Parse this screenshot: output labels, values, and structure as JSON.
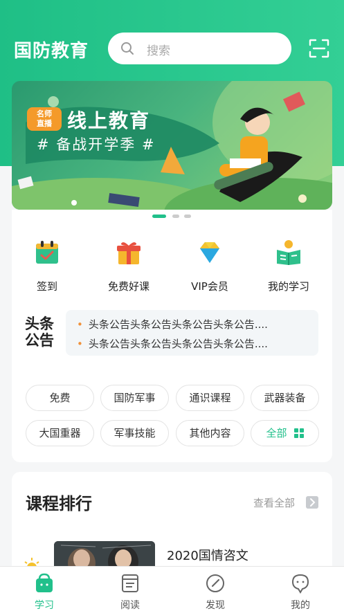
{
  "header": {
    "app_title": "国防教育",
    "search_placeholder": "搜索"
  },
  "banner": {
    "tag_line1": "名师",
    "tag_line2": "直播",
    "title": "线上教育",
    "subtitle": "# 备战开学季 #",
    "page_count": 3,
    "active_page": 1
  },
  "quick_actions": [
    {
      "label": "签到",
      "icon": "calendar-check-icon"
    },
    {
      "label": "免费好课",
      "icon": "gift-icon"
    },
    {
      "label": "VIP会员",
      "icon": "diamond-icon"
    },
    {
      "label": "我的学习",
      "icon": "book-reader-icon"
    }
  ],
  "news": {
    "logo_line1": "头条",
    "logo_line2": "公告",
    "items": [
      "头条公告头条公告头条公告头条公告....",
      "头条公告头条公告头条公告头条公告...."
    ]
  },
  "categories": [
    "免费",
    "国防军事",
    "通识课程",
    "武器装备",
    "大国重器",
    "军事技能",
    "其他内容",
    "全部"
  ],
  "ranking": {
    "title": "课程排行",
    "see_all": "查看全部",
    "first_course_title": "2020国情咨文"
  },
  "tabbar": [
    {
      "label": "学习",
      "icon": "study-bag-icon",
      "active": true
    },
    {
      "label": "阅读",
      "icon": "reading-icon",
      "active": false
    },
    {
      "label": "发现",
      "icon": "compass-icon",
      "active": false
    },
    {
      "label": "我的",
      "icon": "profile-icon",
      "active": false
    }
  ],
  "colors": {
    "accent": "#21c08b",
    "header_bg": "#2cc88f",
    "bullet": "#f0913a"
  }
}
